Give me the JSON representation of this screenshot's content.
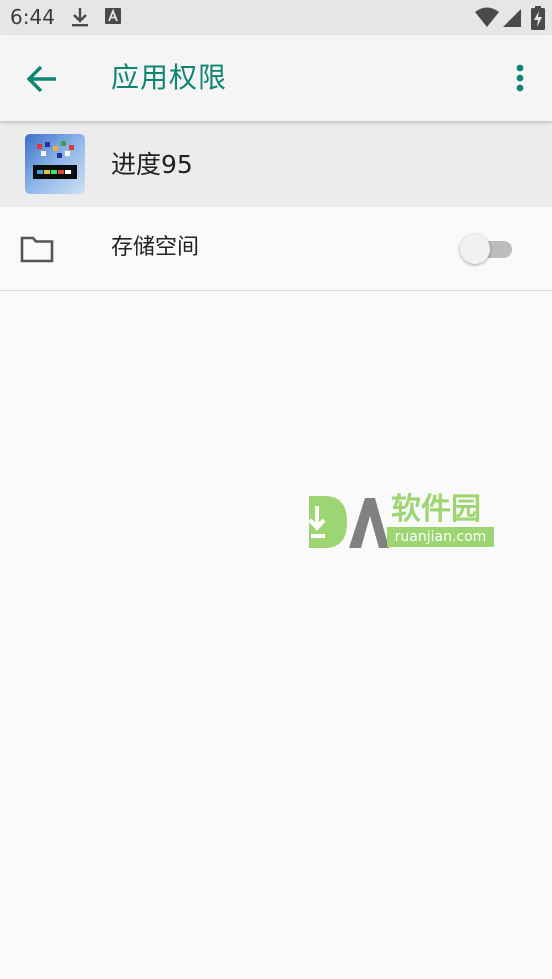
{
  "status_bar": {
    "time": "6:44",
    "icons": [
      "download-icon",
      "font-a-icon",
      "wifi-icon",
      "signal-icon",
      "battery-charging-icon"
    ]
  },
  "app_bar": {
    "title": "应用权限",
    "back_icon": "arrow-back-icon",
    "menu_icon": "more-vert-icon",
    "accent_color": "#0f8574"
  },
  "app_header": {
    "app_name": "进度95",
    "icon": "app-icon"
  },
  "permissions": [
    {
      "label": "存储空间",
      "icon": "folder-icon",
      "enabled": false
    }
  ],
  "watermark": {
    "cn": "软件园",
    "en": "ruanjian.com",
    "color": "#8ccf5a"
  }
}
